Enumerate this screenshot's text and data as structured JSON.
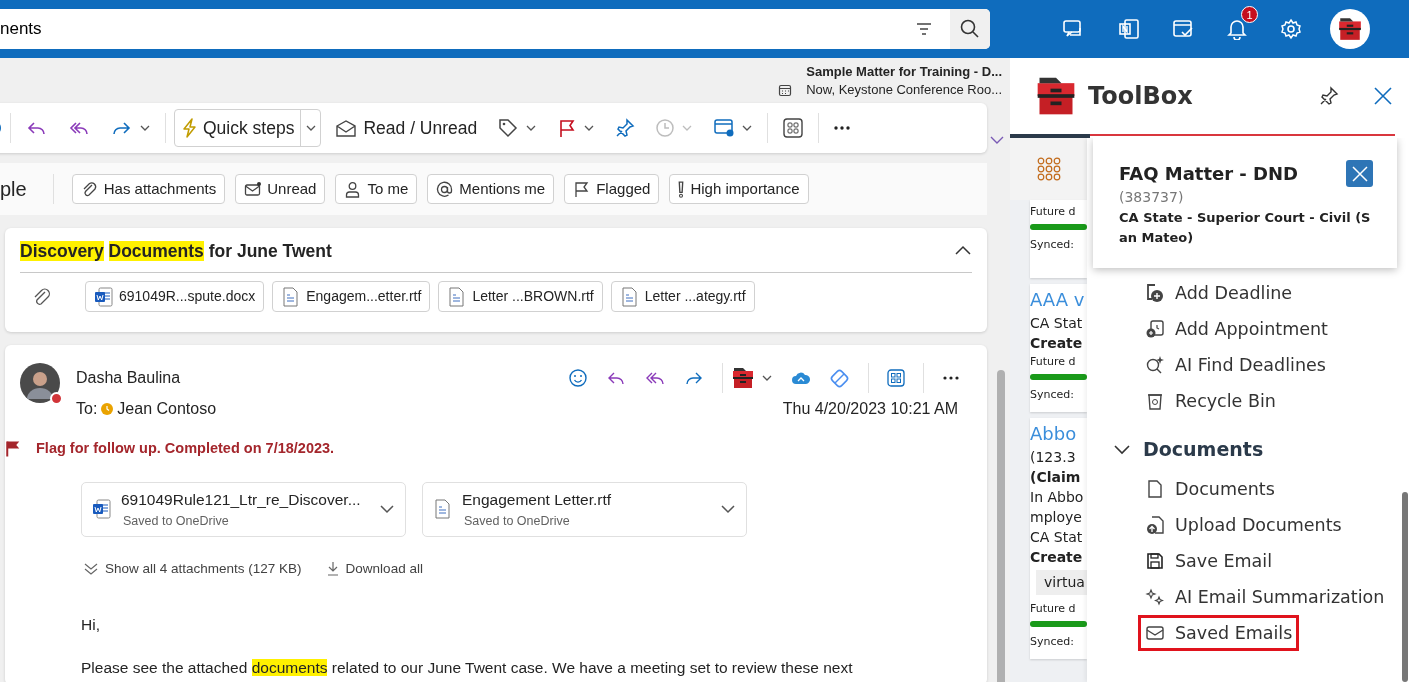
{
  "top_bar": {
    "search": {
      "value": "nents"
    },
    "notification_count": "1"
  },
  "reminder": {
    "title": "Sample Matter for Training - D...",
    "detail": "Now, Keystone Conference Roo..."
  },
  "toolbar": {
    "quick_steps": "Quick steps",
    "read_unread": "Read / Unread",
    "snooze_disabled": true
  },
  "filters": {
    "view_label": "ple",
    "chips": [
      {
        "label": "Has attachments"
      },
      {
        "label": "Unread"
      },
      {
        "label": "To me"
      },
      {
        "label": "Mentions me"
      },
      {
        "label": "Flagged"
      },
      {
        "label": "High importance"
      }
    ]
  },
  "subject": {
    "parts": [
      {
        "text": "Discovery",
        "highlighted": true
      },
      {
        "text": "Documents",
        "highlighted": true
      },
      {
        "text": "for June Twent",
        "highlighted": false
      }
    ],
    "expanded": true,
    "attachments": [
      {
        "name": "691049R...spute.docx",
        "kind": "word"
      },
      {
        "name": "Engagem...etter.rtf",
        "kind": "rtf"
      },
      {
        "name": "Letter ...BROWN.rtf",
        "kind": "rtf"
      },
      {
        "name": "Letter ...ategy.rtf",
        "kind": "rtf"
      }
    ]
  },
  "message": {
    "sender": "Dasha Baulina",
    "sender_busy": true,
    "to_label": "To:",
    "recipient": "Jean Contoso",
    "recipient_away": true,
    "date": "Thu 4/20/2023 10:21 AM",
    "flag_text": "Flag for follow up. Completed on 7/18/2023.",
    "attachments": [
      {
        "name": "691049Rule121_Ltr_re_Discover...",
        "status": "Saved to OneDrive",
        "kind": "word"
      },
      {
        "name": "Engagement Letter.rtf",
        "status": "Saved to OneDrive",
        "kind": "rtf"
      }
    ],
    "show_all": "Show all 4 attachments (127 KB)",
    "download_all": "Download all",
    "body": [
      {
        "parts": [
          {
            "text": "Hi,",
            "highlighted": false
          }
        ]
      },
      {
        "parts": [
          {
            "text": "Please see the attached",
            "highlighted": false
          },
          {
            "text": "documents",
            "highlighted": true
          },
          {
            "text": "related to our June Twent case. We have a meeting set to review these next",
            "highlighted": false
          }
        ]
      }
    ]
  },
  "toolbox": {
    "title": "ToolBox",
    "popover": {
      "title": "FAQ Matter - DND",
      "number": "(383737)",
      "court": "CA State - Superior Court - Civil (San Mateo)"
    },
    "matter_cards": [
      {
        "lines": [
          {
            "kind": "small",
            "text": "Future d"
          },
          {
            "kind": "progress",
            "level": 1
          },
          {
            "kind": "small",
            "text": "Synced:"
          }
        ]
      },
      {
        "lines": [
          {
            "kind": "title",
            "text": "AAA v"
          },
          {
            "kind": "text",
            "text": "CA Stat"
          },
          {
            "kind": "bold",
            "text": "Create"
          },
          {
            "kind": "small",
            "text": "Future d"
          },
          {
            "kind": "progress",
            "level": 1
          },
          {
            "kind": "small",
            "text": "Synced:"
          }
        ]
      },
      {
        "lines": [
          {
            "kind": "title",
            "text": "Abbo"
          },
          {
            "kind": "text",
            "text": "(123.3"
          },
          {
            "kind": "bold",
            "text": "(Claim"
          },
          {
            "kind": "text",
            "text": "In Abbo"
          },
          {
            "kind": "text",
            "text": "mploye"
          },
          {
            "kind": "text",
            "text": "CA Stat"
          },
          {
            "kind": "bold",
            "text": "Create"
          },
          {
            "kind": "tag",
            "text": "virtua"
          },
          {
            "kind": "small",
            "text": "Future d"
          },
          {
            "kind": "progress",
            "level": 1
          },
          {
            "kind": "small",
            "text": "Synced:"
          }
        ]
      }
    ],
    "menu": [
      {
        "kind": "item",
        "label": "Add Deadline",
        "highlighted": false
      },
      {
        "kind": "item",
        "label": "Add Appointment",
        "highlighted": false
      },
      {
        "kind": "item",
        "label": "AI Find Deadlines",
        "highlighted": false
      },
      {
        "kind": "item",
        "label": "Recycle Bin",
        "highlighted": false
      },
      {
        "kind": "section",
        "label": "Documents",
        "expanded": true
      },
      {
        "kind": "item",
        "label": "Documents",
        "highlighted": false
      },
      {
        "kind": "item",
        "label": "Upload Documents",
        "highlighted": false
      },
      {
        "kind": "item",
        "label": "Save Email",
        "highlighted": false
      },
      {
        "kind": "item",
        "label": "AI Email Summarization",
        "highlighted": false
      },
      {
        "kind": "item",
        "label": "Saved Emails",
        "highlighted": true
      }
    ]
  }
}
